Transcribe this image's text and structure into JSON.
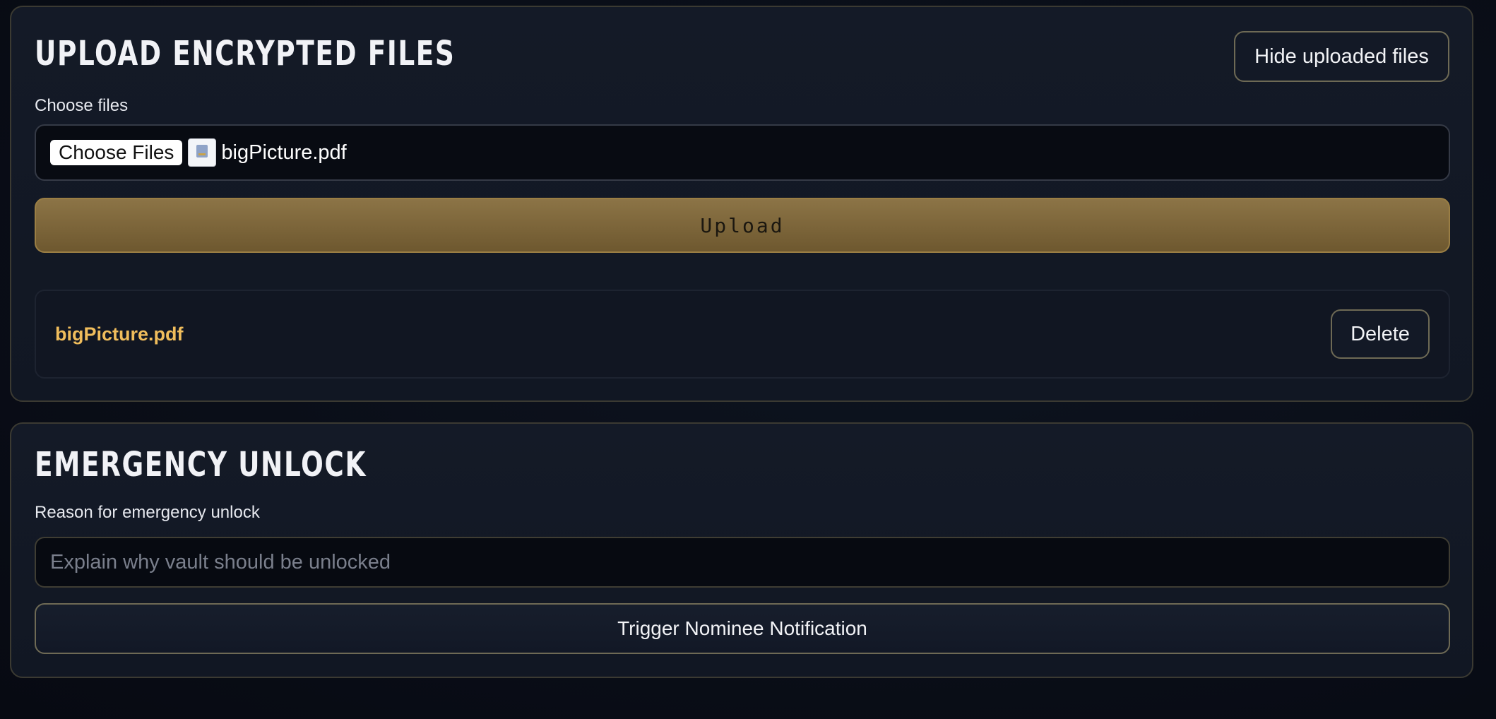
{
  "upload_section": {
    "title": "UPLOAD ENCRYPTED FILES",
    "toggle_label": "Hide uploaded files",
    "choose_label": "Choose files",
    "choose_button_label": "Choose Files",
    "selected_file": "bigPicture.pdf",
    "selected_file_icon": "pdf-file-icon",
    "upload_button_label": "Upload",
    "uploaded_files": [
      {
        "name": "bigPicture.pdf",
        "delete_label": "Delete"
      }
    ],
    "colors": {
      "accent_gold": "#f0bd5c",
      "upload_button": "#7d6639"
    }
  },
  "emergency_section": {
    "title": "EMERGENCY UNLOCK",
    "reason_label": "Reason for emergency unlock",
    "reason_value": "",
    "reason_placeholder": "Explain why vault should be unlocked",
    "trigger_button_label": "Trigger Nominee Notification"
  }
}
